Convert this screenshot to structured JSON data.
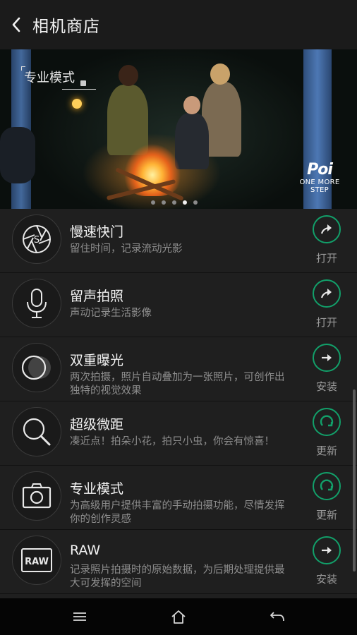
{
  "header": {
    "title": "相机商店",
    "back_icon": "chevron-left-icon"
  },
  "banner": {
    "tag": "专业模式",
    "logo_mark": "Poi",
    "logo_text": "ONE MORE STEP",
    "carousel": {
      "count": 5,
      "active_index": 4
    }
  },
  "modes": [
    {
      "name": "慢速快门",
      "desc": "留住时间，记录流动光影",
      "icon": "shutter-aperture-icon",
      "action_label": "打开",
      "action_icon": "open-arrow-icon"
    },
    {
      "name": "留声拍照",
      "desc": "声动记录生活影像",
      "icon": "microphone-icon",
      "action_label": "打开",
      "action_icon": "open-arrow-icon"
    },
    {
      "name": "双重曝光",
      "desc": "两次拍摄，照片自动叠加为一张照片，可创作出独特的视觉效果",
      "icon": "double-circle-icon",
      "action_label": "安装",
      "action_icon": "install-arrow-icon"
    },
    {
      "name": "超级微距",
      "desc": "凑近点！拍朵小花，拍只小虫，你会有惊喜！",
      "icon": "magnifier-icon",
      "action_label": "更新",
      "action_icon": "update-refresh-icon"
    },
    {
      "name": "专业模式",
      "desc": "为高级用户提供丰富的手动拍摄功能，尽情发挥你的创作灵感",
      "icon": "camera-icon",
      "action_label": "更新",
      "action_icon": "update-refresh-icon"
    },
    {
      "name": "RAW",
      "desc": "记录照片拍摄时的原始数据，为后期处理提供最大可发挥的空间",
      "icon": "raw-badge-icon",
      "icon_text": "RAW",
      "action_label": "安装",
      "action_icon": "install-arrow-icon"
    }
  ],
  "navbar": {
    "menu_icon": "menu-icon",
    "home_icon": "home-icon",
    "back_icon": "back-arrow-icon"
  },
  "colors": {
    "accent": "#12a06a",
    "background": "#1f1f1f",
    "header": "#1b1b1b",
    "navbar": "#050505"
  }
}
